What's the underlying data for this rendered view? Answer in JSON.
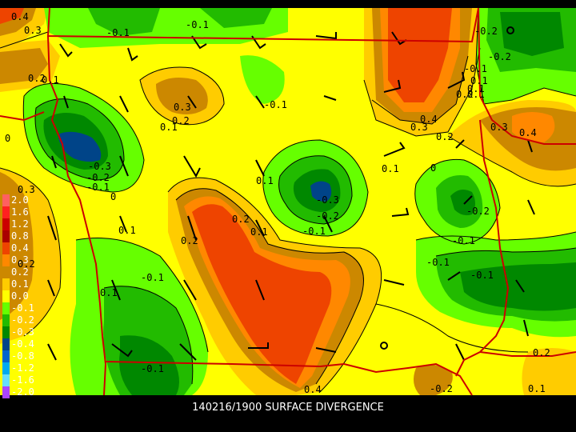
{
  "title": "140216/1900 SURFACE DIVERGENCE",
  "colors": {
    "background": "#000000",
    "field_base": "#ffff00",
    "boundary": "#cc0000",
    "isoline": "#000000"
  },
  "legend": [
    {
      "label": "2.0",
      "color": "#ff6060"
    },
    {
      "label": "1.6",
      "color": "#ff2020"
    },
    {
      "label": "1.2",
      "color": "#cc0000"
    },
    {
      "label": "0.8",
      "color": "#aa0000"
    },
    {
      "label": "0.4",
      "color": "#ee4400"
    },
    {
      "label": "0.3",
      "color": "#ff8800"
    },
    {
      "label": "0.2",
      "color": "#cc8800"
    },
    {
      "label": "0.1",
      "color": "#ffcc00"
    },
    {
      "label": "0.0",
      "color": "#ffff00"
    },
    {
      "label": "-0.1",
      "color": "#66ff00"
    },
    {
      "label": "-0.2",
      "color": "#22bb00"
    },
    {
      "label": "-0.3",
      "color": "#008800"
    },
    {
      "label": "-0.4",
      "color": "#004488"
    },
    {
      "label": "-0.8",
      "color": "#0066cc"
    },
    {
      "label": "-1.2",
      "color": "#00aaee"
    },
    {
      "label": "-1.6",
      "color": "#66ddff"
    },
    {
      "label": "-2.0",
      "color": "#aa44ff"
    }
  ],
  "contour_labels": [
    "0.4",
    "0.3",
    "-0.1",
    "-0.1",
    "0.2",
    "0.1",
    "0.3",
    "0.2",
    "0.1",
    "-0.1",
    "0",
    "-0.3",
    "-0.2",
    "-0.1",
    "0",
    "0.3",
    "0.2",
    "0.1",
    "-0.3",
    "-0.2",
    "-0.1",
    "0.1",
    "0.2",
    "0.1",
    "-0.1",
    "0.4",
    "0.3",
    "0.2",
    "0.1",
    "0",
    "-0.2",
    "-0.1",
    "-0.1",
    "-0.2",
    "0.2",
    "0.1",
    "-0.1",
    "0.4",
    "0.2",
    "0.1",
    "-0.2",
    "-0.1",
    "0.1",
    "0.2",
    "0.1",
    "-0.1",
    "0.3",
    "0.4",
    "0.1",
    "-0.2"
  ]
}
